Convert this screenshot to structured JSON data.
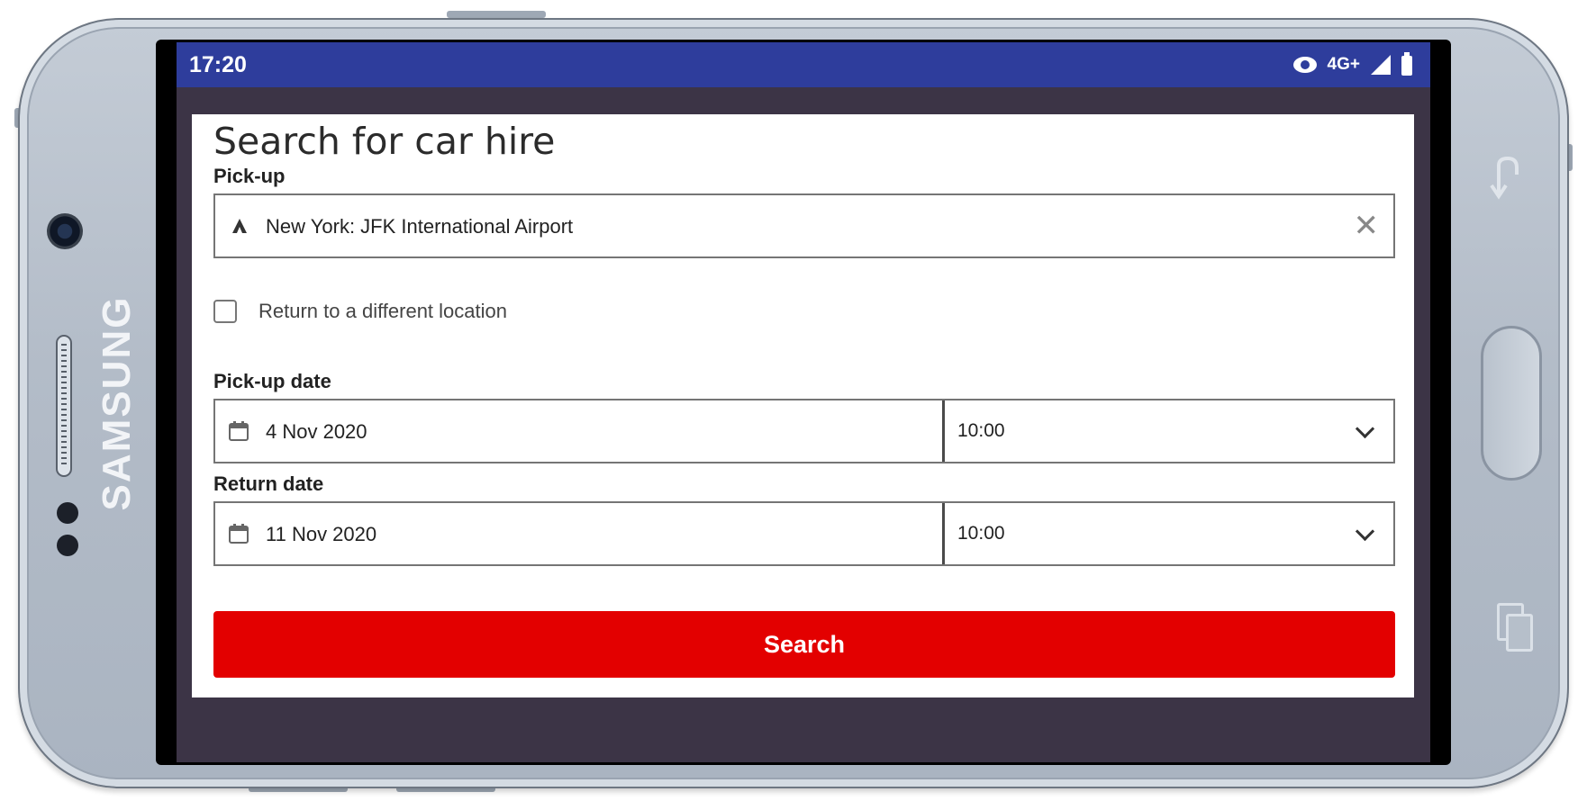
{
  "device": {
    "brand": "SAMSUNG"
  },
  "status_bar": {
    "time": "17:20",
    "network": "4G+",
    "icons": [
      "eye-icon",
      "signal-icon",
      "battery-icon"
    ],
    "background_color": "#2e3d9c"
  },
  "form": {
    "title": "Search for car hire",
    "pickup": {
      "label": "Pick-up",
      "value": "New York: JFK International Airport",
      "icon": "airport-pin-icon",
      "clear_icon": "close-icon"
    },
    "return_different": {
      "label": "Return to a different location",
      "checked": false
    },
    "pickup_date": {
      "label": "Pick-up date",
      "date": "4 Nov 2020",
      "time": "10:00"
    },
    "return_date": {
      "label": "Return date",
      "date": "11 Nov 2020",
      "time": "10:00"
    },
    "search_button": {
      "label": "Search",
      "color": "#e30000"
    }
  }
}
